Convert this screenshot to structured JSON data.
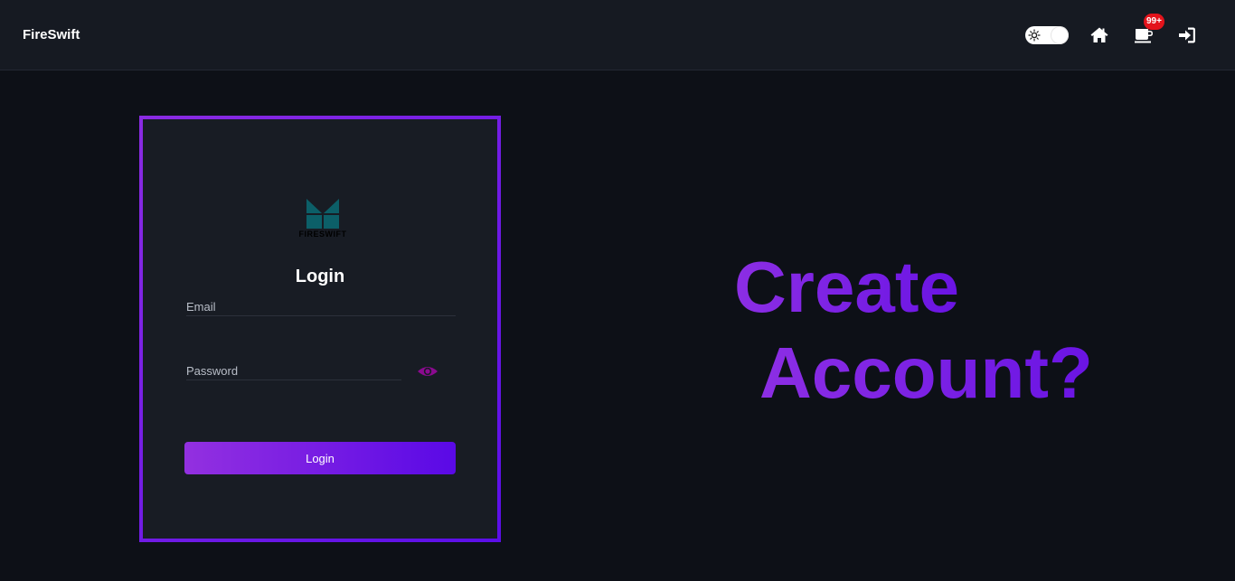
{
  "navbar": {
    "brand": "FireSwift",
    "cart_badge": "99+",
    "icons": [
      "sun-icon",
      "home-icon",
      "coffee-cup-icon",
      "sign-in-icon"
    ]
  },
  "login_card": {
    "logo_text": "FIRESWIFT",
    "title": "Login",
    "email_placeholder": "Email",
    "email_value": "",
    "password_placeholder": "Password",
    "password_value": "",
    "submit_label": "Login"
  },
  "cta": {
    "line1": "Create",
    "line2": "Account?"
  },
  "colors": {
    "background": "#0d1017",
    "navbar": "#161a22",
    "card": "#181c24",
    "accent_start": "#8a2be2",
    "accent_end": "#5b0ee8",
    "eye_icon": "#8b0a8f",
    "badge": "#e3131b",
    "logo": "#0c5f68"
  }
}
